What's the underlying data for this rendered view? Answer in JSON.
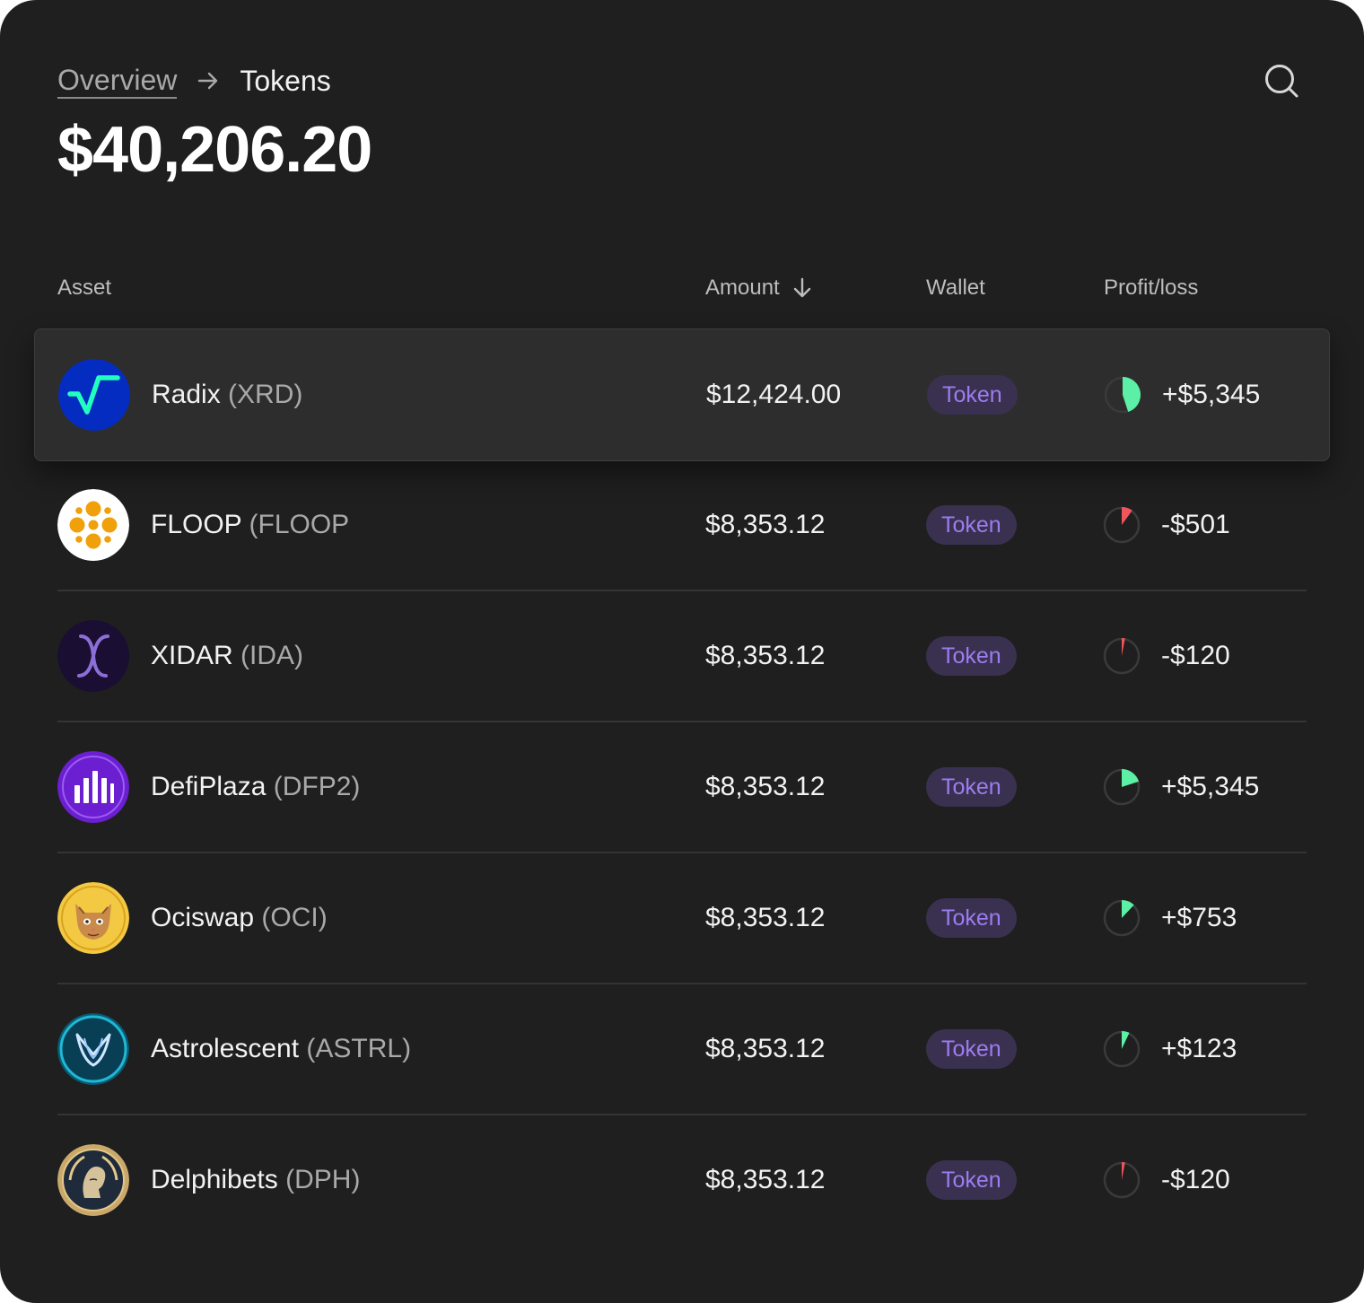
{
  "breadcrumb": {
    "parent": "Overview",
    "current": "Tokens"
  },
  "total_value": "$40,206.20",
  "table": {
    "headers": {
      "asset": "Asset",
      "amount": "Amount",
      "wallet": "Wallet",
      "profit_loss": "Profit/loss"
    },
    "rows": [
      {
        "name": "Radix",
        "ticker": "(XRD)",
        "amount": "$12,424.00",
        "wallet": "Token",
        "profit_loss": "+$5,345",
        "pl_fraction": 0.45,
        "pl_positive": true,
        "logo_icon": "radix-logo-icon"
      },
      {
        "name": "FLOOP",
        "ticker": "(FLOOP",
        "amount": "$8,353.12",
        "wallet": "Token",
        "profit_loss": "-$501",
        "pl_fraction": 0.1,
        "pl_positive": false,
        "logo_icon": "floop-logo-icon"
      },
      {
        "name": "XIDAR",
        "ticker": "(IDA)",
        "amount": "$8,353.12",
        "wallet": "Token",
        "profit_loss": "-$120",
        "pl_fraction": 0.03,
        "pl_positive": false,
        "logo_icon": "xidar-logo-icon"
      },
      {
        "name": "DefiPlaza",
        "ticker": "(DFP2)",
        "amount": "$8,353.12",
        "wallet": "Token",
        "profit_loss": "+$5,345",
        "pl_fraction": 0.2,
        "pl_positive": true,
        "logo_icon": "defiplaza-logo-icon"
      },
      {
        "name": "Ociswap",
        "ticker": "(OCI)",
        "amount": "$8,353.12",
        "wallet": "Token",
        "profit_loss": "+$753",
        "pl_fraction": 0.12,
        "pl_positive": true,
        "logo_icon": "ociswap-logo-icon"
      },
      {
        "name": "Astrolescent",
        "ticker": "(ASTRL)",
        "amount": "$8,353.12",
        "wallet": "Token",
        "profit_loss": "+$123",
        "pl_fraction": 0.07,
        "pl_positive": true,
        "logo_icon": "astrolescent-logo-icon"
      },
      {
        "name": "Delphibets",
        "ticker": "(DPH)",
        "amount": "$8,353.12",
        "wallet": "Token",
        "profit_loss": "-$120",
        "pl_fraction": 0.03,
        "pl_positive": false,
        "logo_icon": "delphibets-logo-icon"
      }
    ]
  },
  "colors": {
    "background": "#1f1f1f",
    "highlight_row": "#2d2d2d",
    "badge_bg": "#3a3150",
    "badge_text": "#9d7cf0",
    "profit": "#5cf0a6",
    "loss": "#f0555c",
    "pie_track": "#3a3a3a"
  },
  "icons": {
    "search": "search-icon",
    "breadcrumb_separator": "arrow-right-icon",
    "sort": "arrow-down-icon"
  }
}
